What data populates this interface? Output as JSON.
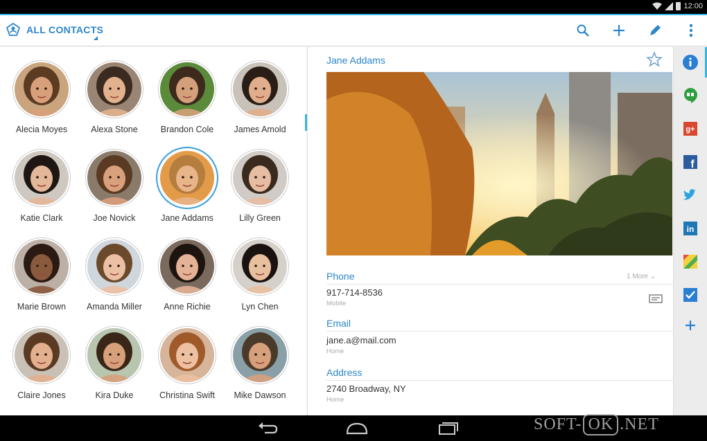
{
  "status_bar": {
    "time": "12:00"
  },
  "action_bar": {
    "title": "ALL CONTACTS",
    "actions": [
      {
        "name": "search",
        "icon": "search-icon"
      },
      {
        "name": "add",
        "icon": "plus-icon"
      },
      {
        "name": "edit",
        "icon": "pencil-icon"
      },
      {
        "name": "overflow",
        "icon": "more-vert-icon"
      }
    ],
    "accent": "#33b5e5"
  },
  "contacts": [
    {
      "name": "Alecia Moyes"
    },
    {
      "name": "Alexa Stone"
    },
    {
      "name": "Brandon Cole"
    },
    {
      "name": "James Amold"
    },
    {
      "name": "Katie Clark"
    },
    {
      "name": "Joe Novick"
    },
    {
      "name": "Jane Addams",
      "selected": true
    },
    {
      "name": "Lilly Green"
    },
    {
      "name": "Marie Brown"
    },
    {
      "name": "Amanda Miller"
    },
    {
      "name": "Anne Richie"
    },
    {
      "name": "Lyn Chen"
    },
    {
      "name": "Claire Jones"
    },
    {
      "name": "Kira Duke"
    },
    {
      "name": "Christina Swift"
    },
    {
      "name": "Mike Dawson"
    }
  ],
  "detail": {
    "name": "Jane Addams",
    "phone": {
      "header": "Phone",
      "more": "1 More",
      "value": "917-714-8536",
      "type": "Mobile"
    },
    "email": {
      "header": "Email",
      "value": "jane.a@mail.com",
      "type": "Home"
    },
    "address": {
      "header": "Address",
      "value": "2740 Broadway, NY",
      "type": "Home"
    }
  },
  "rail": [
    {
      "icon": "info-icon",
      "color": "#2a7fd4"
    },
    {
      "icon": "hangouts-icon",
      "color": "#2e9e3e"
    },
    {
      "icon": "google-plus-icon",
      "color": "#d9472f"
    },
    {
      "icon": "facebook-icon",
      "color": "#2b5b9e"
    },
    {
      "icon": "twitter-icon",
      "color": "#2aa3e0"
    },
    {
      "icon": "linkedin-icon",
      "color": "#1f78b4"
    },
    {
      "icon": "maps-icon",
      "color": "#4caf50"
    },
    {
      "icon": "tasks-icon",
      "color": "#2a7fd4"
    },
    {
      "icon": "add-icon",
      "color": "#2a7fd4"
    }
  ],
  "nav": [
    "back-icon",
    "home-icon",
    "recents-icon"
  ],
  "watermark": {
    "part1": "SOFT-",
    "part2": "OK",
    "part3": ".NET"
  }
}
